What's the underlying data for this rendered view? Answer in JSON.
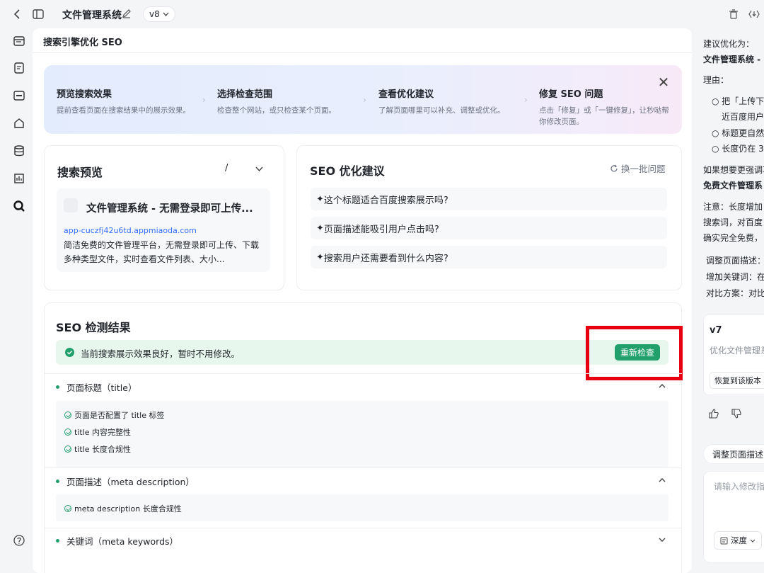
{
  "topbar": {
    "app_title": "文件管理系统",
    "version": "v8"
  },
  "main": {
    "page_title": "搜索引擎优化 SEO",
    "steps": [
      {
        "title": "预览搜索效果",
        "desc": "提前查看页面在搜索结果中的展示效果。"
      },
      {
        "title": "选择检查范围",
        "desc": "检查整个网站，或只检查某个页面。"
      },
      {
        "title": "查看优化建议",
        "desc": "了解页面哪里可以补充、调整或优化。"
      },
      {
        "title": "修复 SEO 问题",
        "desc": "点击「修复」或「一键修复」，让秒哒帮你修改页面。"
      }
    ],
    "preview": {
      "heading": "搜索预览",
      "path": "/",
      "result_title": "文件管理系统 - 无需登录即可上传...",
      "result_url": "app-cuczfj42u6td.appmiaoda.com",
      "result_desc": "简洁免费的文件管理平台，无需登录即可上传、下载多种类型文件，实时查看文件列表、大小..."
    },
    "suggestions": {
      "heading": "SEO 优化建议",
      "refresh_label": "换一批问题",
      "items": [
        "这个标题适合百度搜索展示吗?",
        "页面描述能吸引用户点击吗?",
        "搜索用户还需要看到什么内容?"
      ]
    },
    "results": {
      "heading": "SEO 检测结果",
      "status_text": "当前搜索展示效果良好，暂时不用修改。",
      "recheck_label": "重新检查",
      "sections": [
        {
          "label": "页面标题（title）",
          "checks": [
            "页面是否配置了 title 标签",
            "title 内容完整性",
            "title 长度合规性"
          ]
        },
        {
          "label": "页面描述（meta description）",
          "checks": [
            "meta description 长度合规性"
          ]
        },
        {
          "label": "关键词（meta keywords）",
          "checks": []
        }
      ]
    }
  },
  "right_panel": {
    "line1": "建议优化为：",
    "line2": "文件管理系统 -",
    "line3": "理由：",
    "bullets": [
      "把「上传下",
      "近百度用户",
      "标题更自然",
      "长度仍在 3"
    ],
    "line4": "如果想要更强调功",
    "line5": "免费文件管理系",
    "line6": "注意：长度增加",
    "line7": "搜索词，对百度",
    "line8": "确实完全免费，",
    "line9": "调整页面描述：",
    "line10": "增加关键词：在",
    "line11": "对比方案：对比",
    "version_card": {
      "name": "v7",
      "desc": "优化文件管理系",
      "restore_label": "恢复到该版本"
    },
    "chip_label": "调整页面描述",
    "input_placeholder": "请输入修改指",
    "depth_label": "深度"
  }
}
